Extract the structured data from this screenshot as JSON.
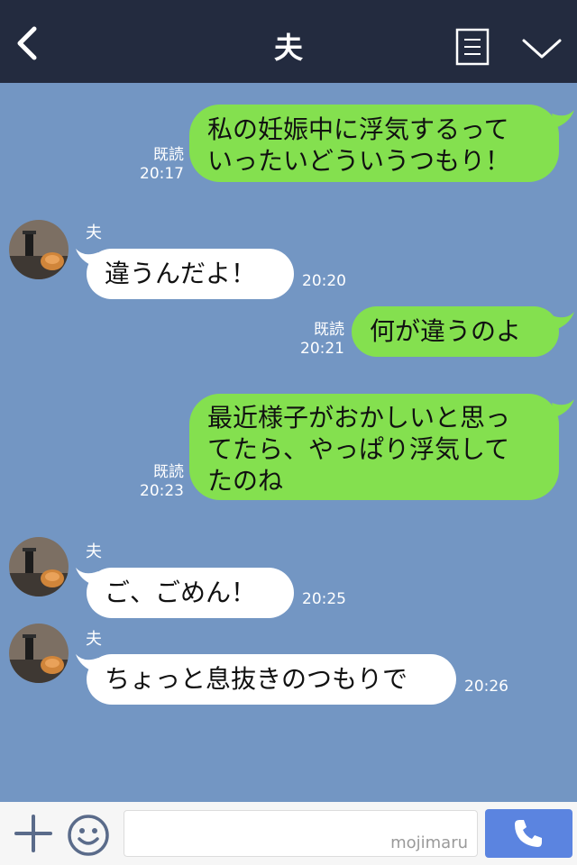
{
  "header": {
    "title": "夫"
  },
  "messages": [
    {
      "from": "me",
      "lines": [
        "私の妊娠中に浮気するって",
        "いったいどういうつもり！"
      ],
      "read": "既読",
      "time": "20:17"
    },
    {
      "from": "them",
      "sender": "夫",
      "lines": [
        "違うんだよ！"
      ],
      "time": "20:20"
    },
    {
      "from": "me",
      "lines": [
        "何が違うのよ"
      ],
      "read": "既読",
      "time": "20:21"
    },
    {
      "from": "me",
      "lines": [
        "最近様子がおかしいと思っ",
        "てたら、やっぱり浮気して",
        "たのね"
      ],
      "read": "既読",
      "time": "20:23"
    },
    {
      "from": "them",
      "sender": "夫",
      "lines": [
        "ご、ごめん！"
      ],
      "time": "20:25"
    },
    {
      "from": "them",
      "sender": "夫",
      "lines": [
        "ちょっと息抜きのつもりで"
      ],
      "time": "20:26"
    }
  ],
  "input": {
    "watermark": "mojimaru"
  },
  "colors": {
    "header_bg": "#232b3f",
    "chat_bg": "#7396c3",
    "my_bubble": "#84e04f",
    "their_bubble": "#ffffff",
    "call_button": "#5b84e0"
  }
}
